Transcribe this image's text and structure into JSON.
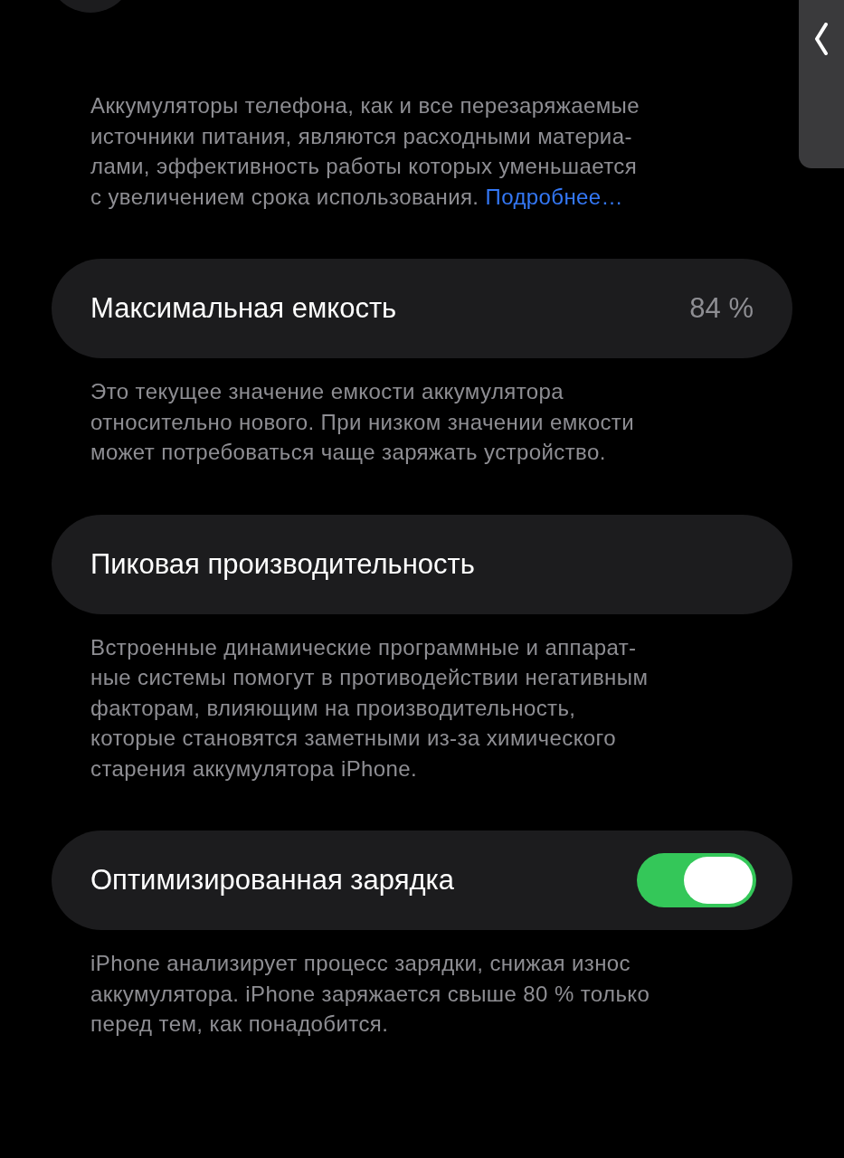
{
  "intro": {
    "lines": [
      "Аккумуляторы телефона, как и все перезаряжаемые",
      "источники питания, являются расходными материа-",
      "лами, эффективность работы которых уменьшается",
      "с увеличением срока использования."
    ],
    "link": "Подробнее…"
  },
  "sections": [
    {
      "kind": "value",
      "label": "Максимальная емкость",
      "value": "84 %",
      "note": [
        "Это текущее значение емкости аккумулятора",
        "относительно нового. При низком значении емкости",
        "может потребоваться чаще заряжать устройство."
      ]
    },
    {
      "kind": "plain",
      "label": "Пиковая производительность",
      "note": [
        "Встроенные динамические программные и аппарат-",
        "ные системы помогут в противодействии негативным",
        "факторам, влияющим на производительность,",
        "которые становятся заметными из-за химического",
        "старения аккумулятора iPhone."
      ]
    },
    {
      "kind": "toggle",
      "label": "Оптимизированная зарядка",
      "on": true,
      "note": [
        "iPhone анализирует процесс зарядки, снижая износ",
        "аккумулятора. iPhone заряжается свыше 80 % только",
        "перед тем, как понадобится."
      ]
    }
  ]
}
